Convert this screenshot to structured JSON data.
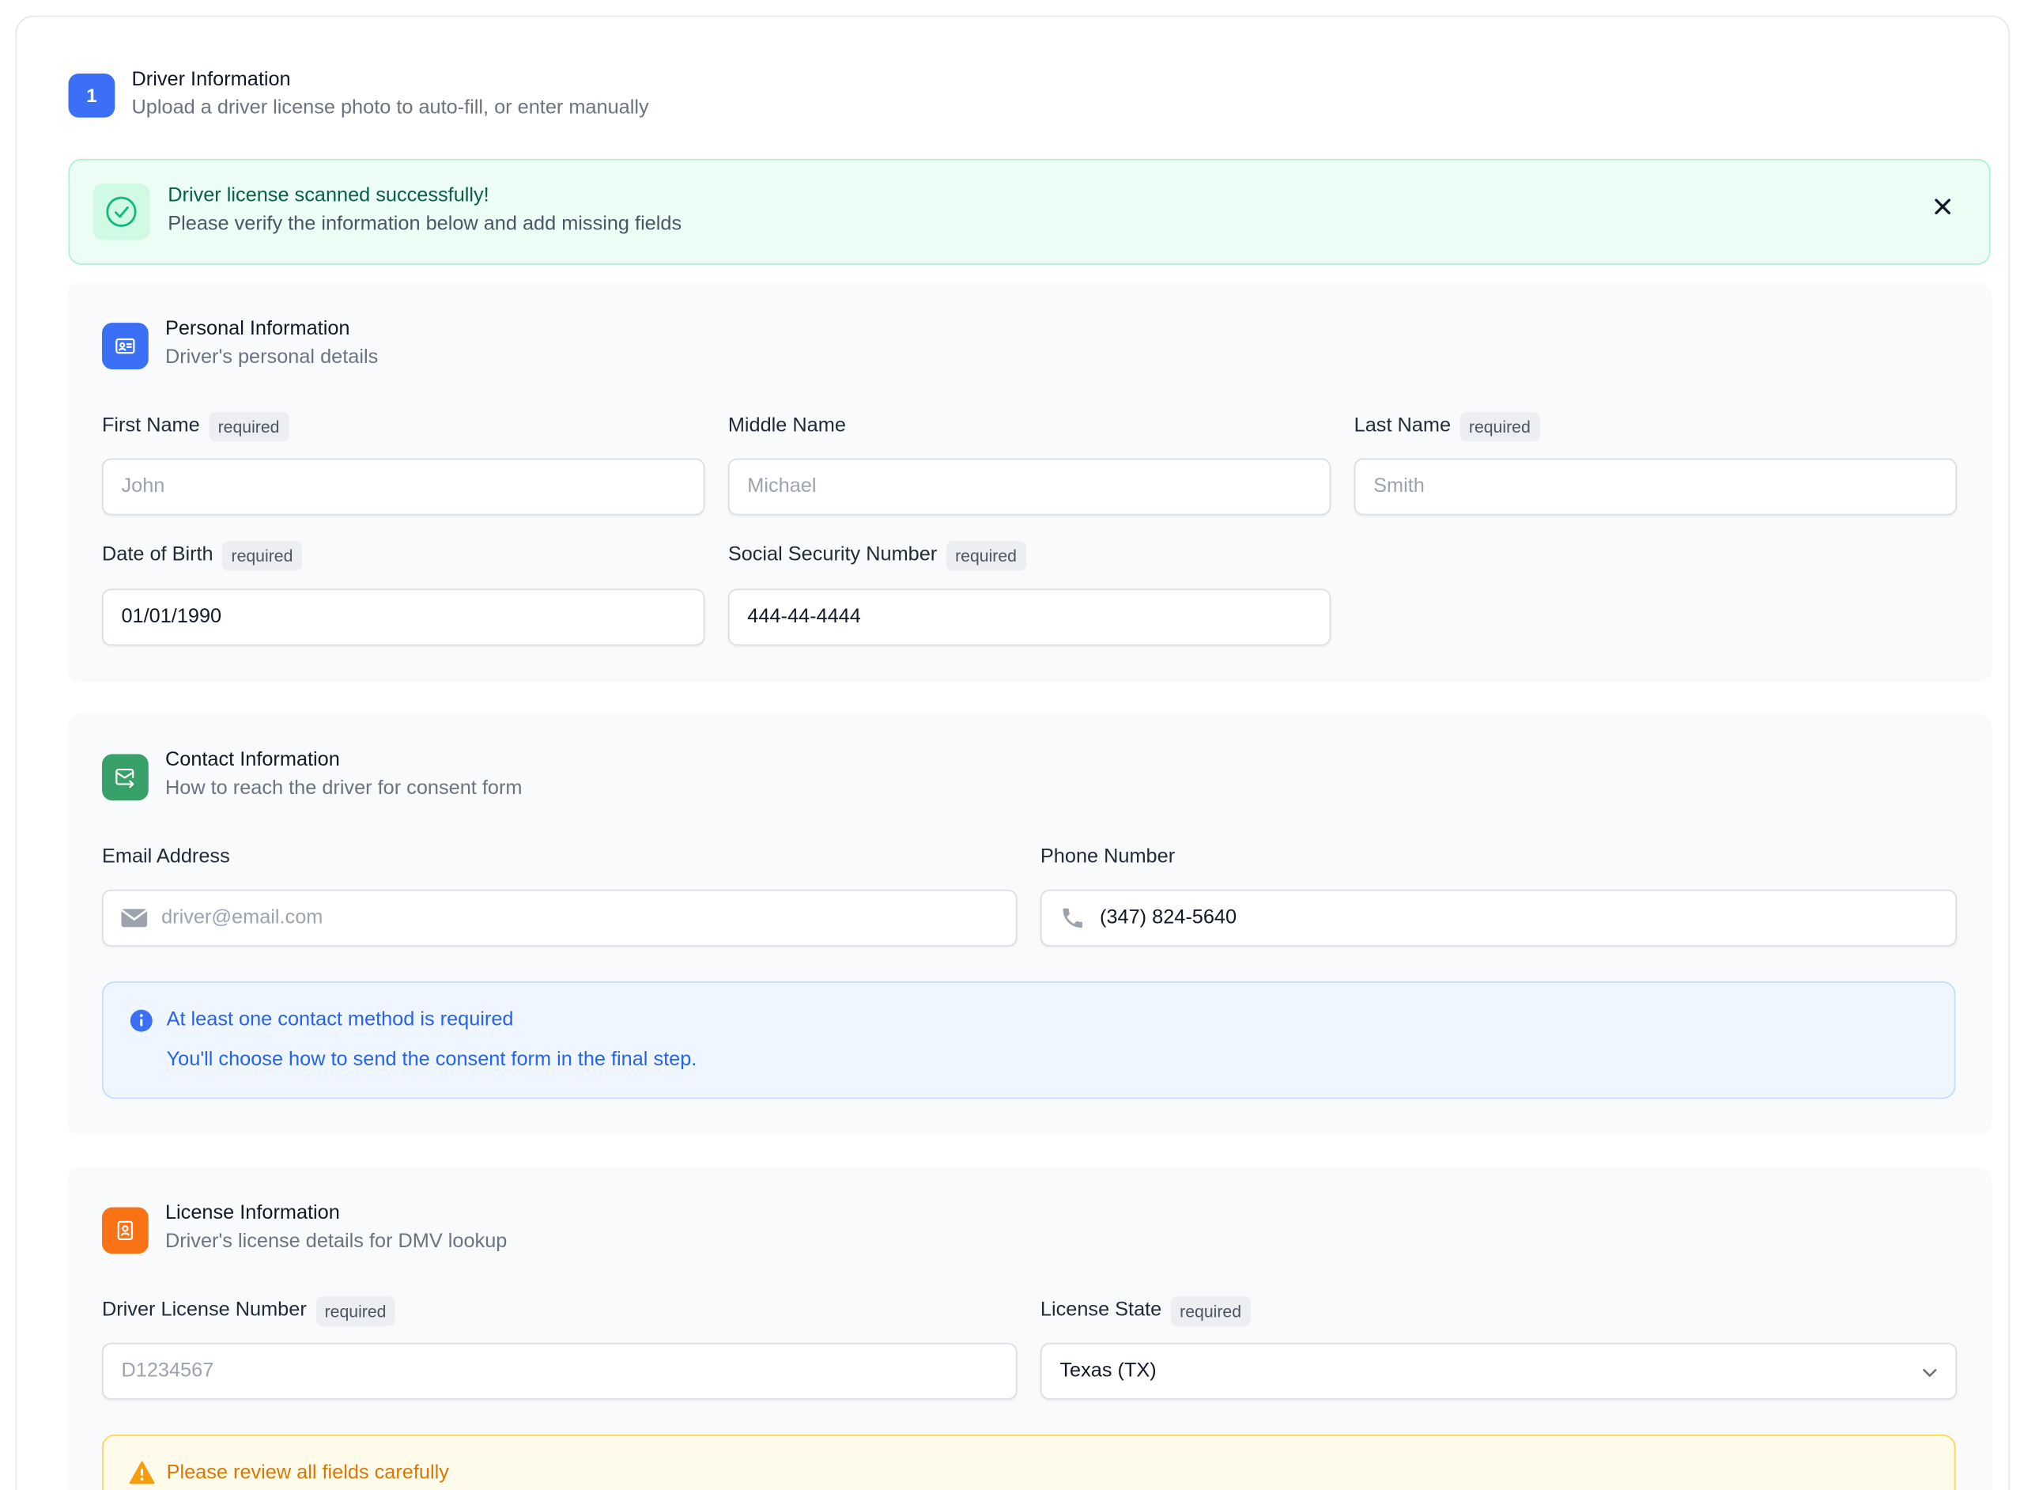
{
  "step": {
    "number": "1",
    "title": "Driver Information",
    "subtitle": "Upload a driver license photo to auto-fill, or enter manually"
  },
  "success_alert": {
    "title": "Driver license scanned successfully!",
    "message": "Please verify the information below and add missing fields",
    "icon": "check-circle-icon",
    "close_icon": "close-icon"
  },
  "personal": {
    "title": "Personal Information",
    "subtitle": "Driver's personal details",
    "icon": "id-card-icon",
    "icon_color": "#3b6ff5",
    "fields": {
      "first_name": {
        "label": "First Name",
        "required": "required",
        "placeholder": "John",
        "value": ""
      },
      "middle_name": {
        "label": "Middle Name",
        "placeholder": "Michael",
        "value": ""
      },
      "last_name": {
        "label": "Last Name",
        "required": "required",
        "placeholder": "Smith",
        "value": ""
      },
      "dob": {
        "label": "Date of Birth",
        "required": "required",
        "placeholder": "",
        "value": "01/01/1990"
      },
      "ssn": {
        "label": "Social Security Number",
        "required": "required",
        "placeholder": "",
        "value": "444-44-4444"
      }
    }
  },
  "contact": {
    "title": "Contact Information",
    "subtitle": "How to reach the driver for consent form",
    "icon": "mail-send-icon",
    "icon_color": "#38a169",
    "fields": {
      "email": {
        "label": "Email Address",
        "placeholder": "driver@email.com",
        "value": "",
        "icon": "envelope-icon"
      },
      "phone": {
        "label": "Phone Number",
        "placeholder": "",
        "value": "(347) 824-5640",
        "icon": "phone-icon"
      }
    },
    "info": {
      "title": "At least one contact method is required",
      "message": "You'll choose how to send the consent form in the final step.",
      "icon": "info-icon"
    }
  },
  "license": {
    "title": "License Information",
    "subtitle": "Driver's license details for DMV lookup",
    "icon": "license-icon",
    "icon_color": "#f97316",
    "fields": {
      "number": {
        "label": "Driver License Number",
        "required": "required",
        "placeholder": "D1234567",
        "value": ""
      },
      "state": {
        "label": "License State",
        "required": "required",
        "value": "Texas (TX)"
      }
    },
    "warning": {
      "title": "Please review all fields carefully",
      "icon": "warning-triangle-icon"
    }
  }
}
